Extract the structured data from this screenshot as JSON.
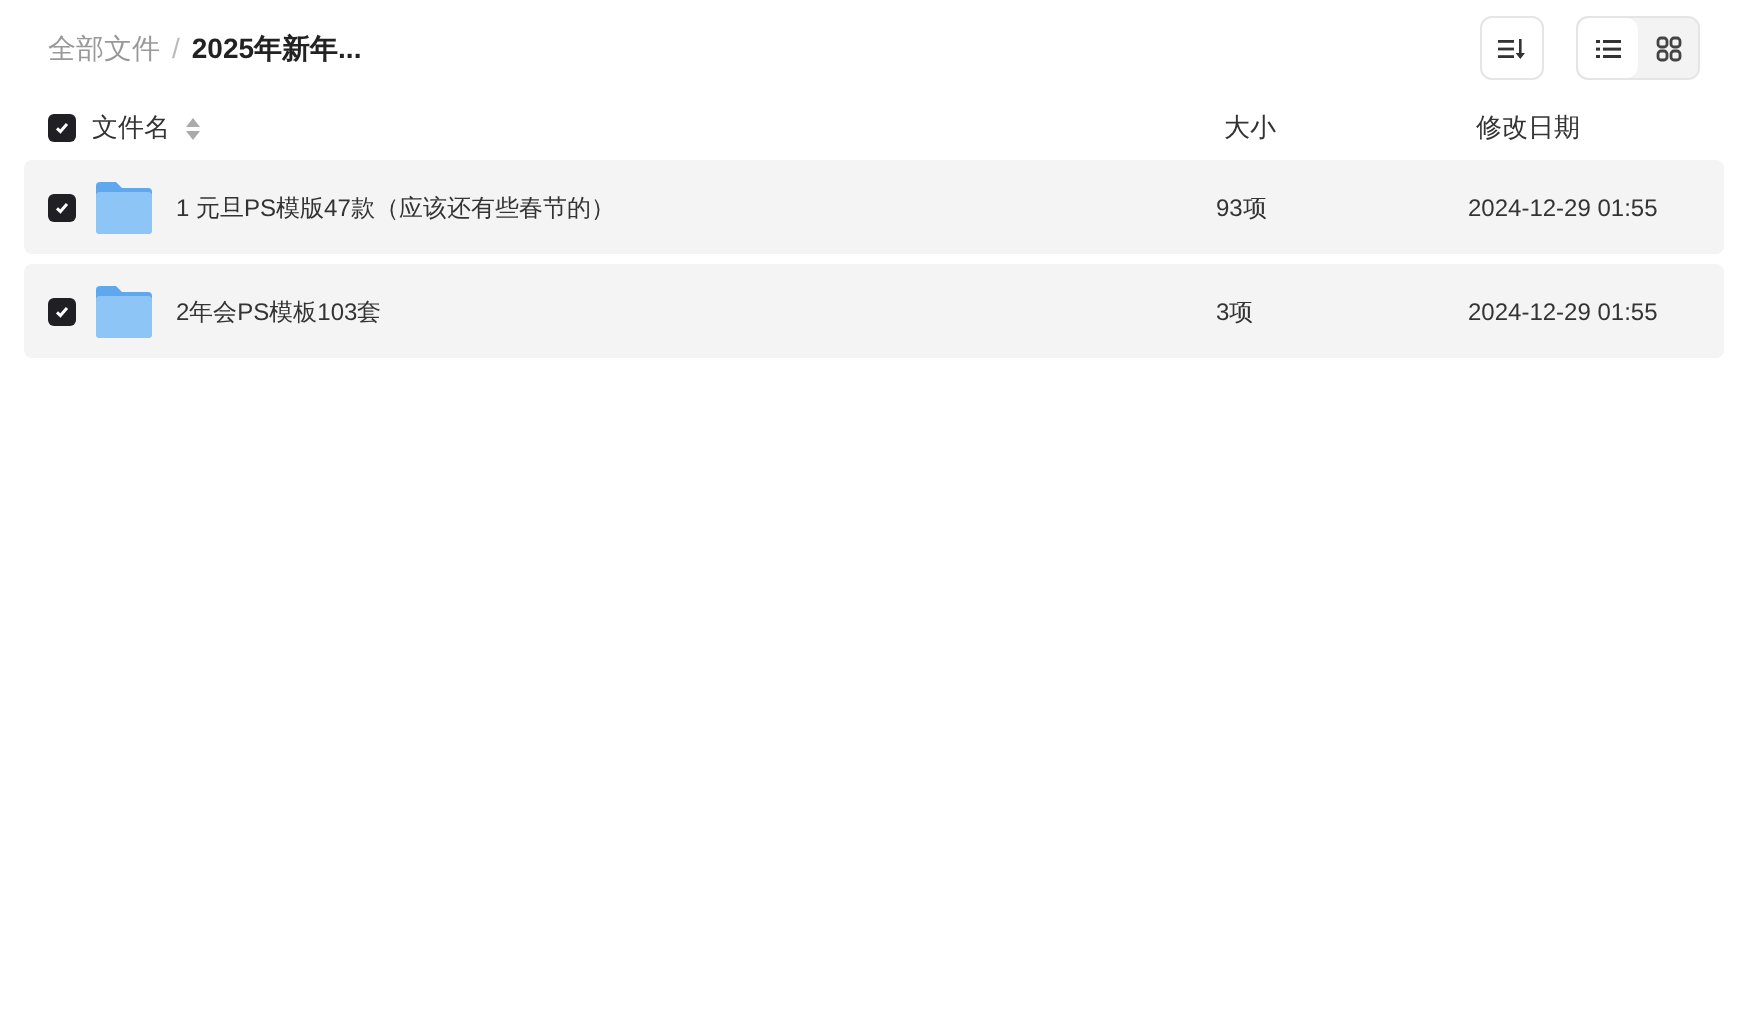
{
  "breadcrumb_separator": "/",
  "breadcrumb": [
    {
      "label": "全部文件",
      "current": false
    },
    {
      "label": "2025年新年...",
      "current": true
    }
  ],
  "view_toggle": [
    {
      "kind": "list",
      "selected": true
    },
    {
      "kind": "grid",
      "selected": false
    }
  ],
  "table": {
    "select_all": {
      "checked": true
    },
    "columns": [
      "文件名",
      "大小",
      "修改日期"
    ],
    "rows": [
      {
        "checked": true,
        "name": "1 元旦PS模版47款（应该还有些春节的）",
        "size": "93项",
        "date": "2024-12-29 01:55"
      },
      {
        "checked": true,
        "name": "2年会PS模板103套",
        "size": "3项",
        "date": "2024-12-29 01:55"
      }
    ]
  }
}
